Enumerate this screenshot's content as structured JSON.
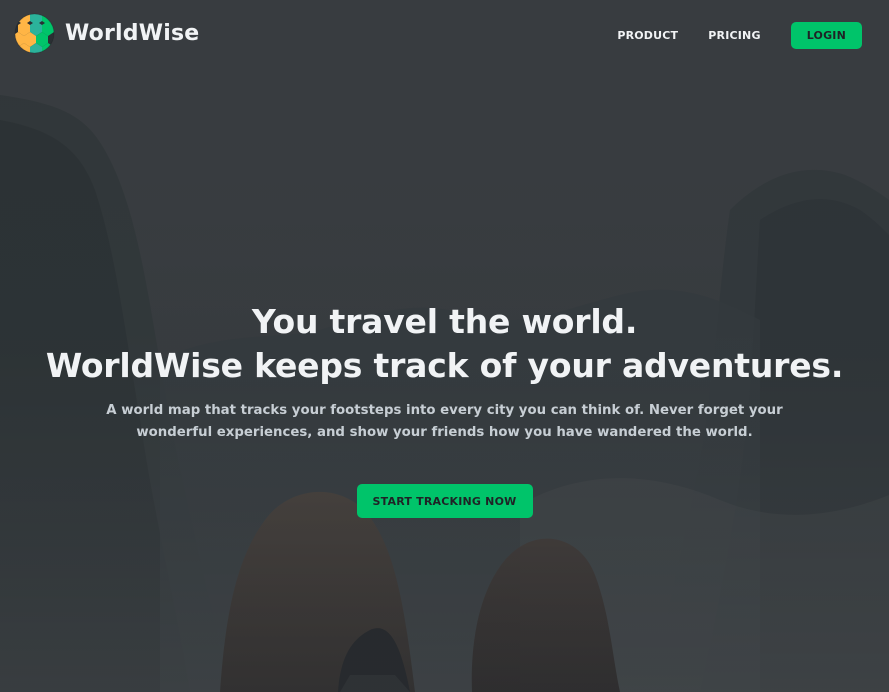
{
  "brand": {
    "name": "WorldWise",
    "logo_icon": "globe-hex-logo-icon",
    "colors": {
      "accent_green": "#00c46a",
      "accent_yellow": "#ffb545",
      "accent_teal": "#2bb39b",
      "text_light": "#f1f3f5",
      "text_muted": "#c7ced4",
      "overlay": "rgba(42,45,49,0.6)"
    }
  },
  "nav": {
    "product": "PRODUCT",
    "pricing": "PRICING",
    "login": "LOGIN"
  },
  "hero": {
    "headline_line1": "You travel the world.",
    "headline_line2": "WorldWise keeps track of your adventures.",
    "subheadline": "A world map that tracks your footsteps into every city you can think of. Never forget your wonderful experiences, and show your friends how you have wandered the world.",
    "cta": "START TRACKING NOW"
  }
}
